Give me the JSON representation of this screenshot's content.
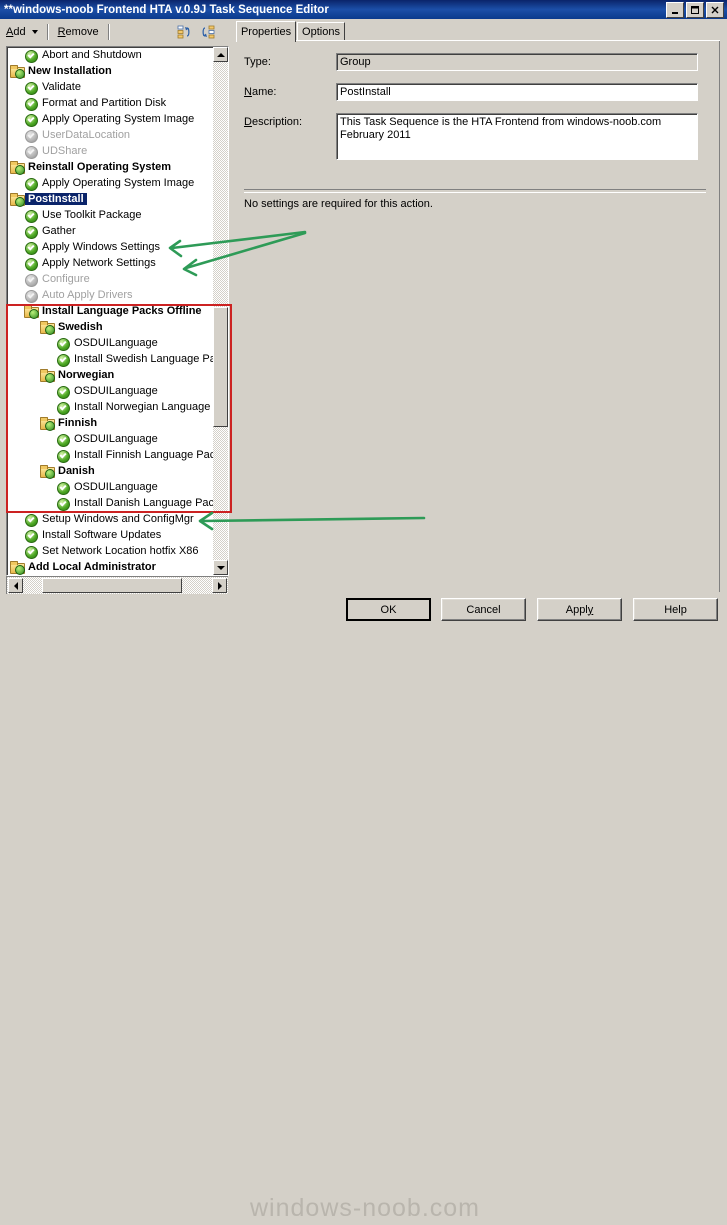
{
  "window": {
    "title": "**windows-noob Frontend HTA v.0.9J Task Sequence Editor",
    "minimize_label": "minimize-icon",
    "maximize_label": "maximize-icon",
    "close_label": "close-icon"
  },
  "toolbar": {
    "add_label": "Add",
    "remove_label": "Remove",
    "move_up_icon": "move-up-icon",
    "move_down_icon": "move-down-icon"
  },
  "tree": {
    "items": [
      {
        "label": "Abort and Shutdown",
        "icon": "check",
        "indent": 1,
        "group": false,
        "disabled": false,
        "selected": false
      },
      {
        "label": "New Installation",
        "icon": "folder",
        "indent": 0,
        "group": true,
        "disabled": false,
        "selected": false
      },
      {
        "label": "Validate",
        "icon": "check",
        "indent": 1,
        "group": false,
        "disabled": false,
        "selected": false
      },
      {
        "label": "Format and Partition Disk",
        "icon": "check",
        "indent": 1,
        "group": false,
        "disabled": false,
        "selected": false
      },
      {
        "label": "Apply Operating System Image",
        "icon": "check",
        "indent": 1,
        "group": false,
        "disabled": false,
        "selected": false
      },
      {
        "label": "UserDataLocation",
        "icon": "check",
        "indent": 1,
        "group": false,
        "disabled": true,
        "selected": false
      },
      {
        "label": "UDShare",
        "icon": "check",
        "indent": 1,
        "group": false,
        "disabled": true,
        "selected": false
      },
      {
        "label": "Reinstall Operating System",
        "icon": "folder",
        "indent": 0,
        "group": true,
        "disabled": false,
        "selected": false
      },
      {
        "label": "Apply Operating System Image",
        "icon": "check",
        "indent": 1,
        "group": false,
        "disabled": false,
        "selected": false
      },
      {
        "label": "PostInstall",
        "icon": "folder",
        "indent": 0,
        "group": true,
        "disabled": false,
        "selected": true
      },
      {
        "label": "Use Toolkit Package",
        "icon": "check",
        "indent": 1,
        "group": false,
        "disabled": false,
        "selected": false
      },
      {
        "label": "Gather",
        "icon": "check",
        "indent": 1,
        "group": false,
        "disabled": false,
        "selected": false
      },
      {
        "label": "Apply Windows Settings",
        "icon": "check",
        "indent": 1,
        "group": false,
        "disabled": false,
        "selected": false
      },
      {
        "label": "Apply Network Settings",
        "icon": "check",
        "indent": 1,
        "group": false,
        "disabled": false,
        "selected": false
      },
      {
        "label": "Configure",
        "icon": "check",
        "indent": 1,
        "group": false,
        "disabled": true,
        "selected": false
      },
      {
        "label": "Auto Apply Drivers",
        "icon": "check",
        "indent": 1,
        "group": false,
        "disabled": true,
        "selected": false
      },
      {
        "label": "Install Language Packs Offline",
        "icon": "folder",
        "indent": 1,
        "group": true,
        "disabled": false,
        "selected": false
      },
      {
        "label": "Swedish",
        "icon": "folder",
        "indent": 2,
        "group": true,
        "disabled": false,
        "selected": false
      },
      {
        "label": "OSDUILanguage",
        "icon": "check",
        "indent": 3,
        "group": false,
        "disabled": false,
        "selected": false
      },
      {
        "label": "Install Swedish Language Pack",
        "icon": "check",
        "indent": 3,
        "group": false,
        "disabled": false,
        "selected": false
      },
      {
        "label": "Norwegian",
        "icon": "folder",
        "indent": 2,
        "group": true,
        "disabled": false,
        "selected": false
      },
      {
        "label": "OSDUILanguage",
        "icon": "check",
        "indent": 3,
        "group": false,
        "disabled": false,
        "selected": false
      },
      {
        "label": "Install Norwegian Language Pack",
        "icon": "check",
        "indent": 3,
        "group": false,
        "disabled": false,
        "selected": false
      },
      {
        "label": "Finnish",
        "icon": "folder",
        "indent": 2,
        "group": true,
        "disabled": false,
        "selected": false
      },
      {
        "label": "OSDUILanguage",
        "icon": "check",
        "indent": 3,
        "group": false,
        "disabled": false,
        "selected": false
      },
      {
        "label": "Install Finnish Language Pack",
        "icon": "check",
        "indent": 3,
        "group": false,
        "disabled": false,
        "selected": false
      },
      {
        "label": "Danish",
        "icon": "folder",
        "indent": 2,
        "group": true,
        "disabled": false,
        "selected": false
      },
      {
        "label": "OSDUILanguage",
        "icon": "check",
        "indent": 3,
        "group": false,
        "disabled": false,
        "selected": false
      },
      {
        "label": "Install Danish Language Pack",
        "icon": "check",
        "indent": 3,
        "group": false,
        "disabled": false,
        "selected": false
      },
      {
        "label": "Setup Windows and ConfigMgr",
        "icon": "check",
        "indent": 1,
        "group": false,
        "disabled": false,
        "selected": false
      },
      {
        "label": "Install Software Updates",
        "icon": "check",
        "indent": 1,
        "group": false,
        "disabled": false,
        "selected": false
      },
      {
        "label": "Set Network Location hotfix X86",
        "icon": "check",
        "indent": 1,
        "group": false,
        "disabled": false,
        "selected": false
      },
      {
        "label": "Add Local Administrator",
        "icon": "folder",
        "indent": 0,
        "group": true,
        "disabled": false,
        "selected": false
      }
    ]
  },
  "tabs": [
    {
      "label": "Properties",
      "active": true
    },
    {
      "label": "Options",
      "active": false
    }
  ],
  "properties": {
    "type_label": "Type:",
    "type_value": "Group",
    "name_label": "Name:",
    "name_label_accel": "N",
    "name_value": "PostInstall",
    "description_label": "Description:",
    "description_label_accel": "D",
    "description_value": "This Task Sequence is the HTA Frontend from windows-noob.com\nFebruary 2011",
    "note": "No settings are required  for this action."
  },
  "buttons": {
    "ok": "OK",
    "cancel": "Cancel",
    "apply": "Apply",
    "apply_accel": "y",
    "help": "Help"
  },
  "watermark": "windows-noob.com",
  "annotations": {
    "highlight_color": "#cc2222",
    "arrow_color": "#2e9b57",
    "arrow_count": 3
  }
}
